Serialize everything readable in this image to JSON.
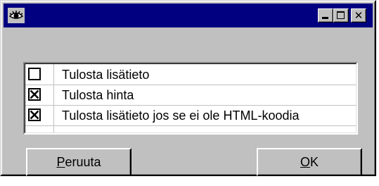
{
  "window": {
    "icon": "eye-icon",
    "controls": {
      "minimize_icon": "minimize-icon",
      "maximize_icon": "maximize-icon",
      "close_icon": "close-icon",
      "close_glyph": "✕"
    }
  },
  "options": [
    {
      "label": "Tulosta lisätieto",
      "checked": false
    },
    {
      "label": "Tulosta hinta",
      "checked": true
    },
    {
      "label": "Tulosta lisätieto jos se ei ole HTML-koodia",
      "checked": true
    }
  ],
  "buttons": {
    "cancel": {
      "mnemonic": "P",
      "rest": "eruuta"
    },
    "ok": {
      "mnemonic": "O",
      "rest": "K"
    }
  },
  "colors": {
    "titlebar": "#000080",
    "face": "#c0c0c0"
  }
}
